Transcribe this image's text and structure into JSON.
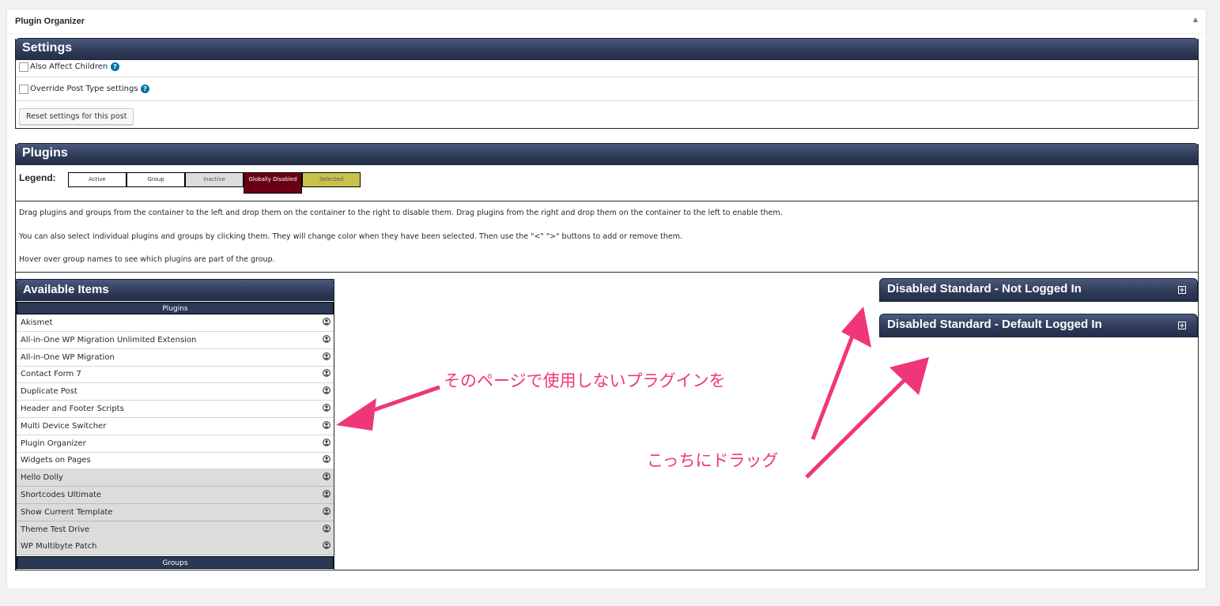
{
  "postbox": {
    "title": "Plugin Organizer"
  },
  "settings": {
    "title": "Settings",
    "also_affect_children": "Also Affect Children",
    "override_post_type": "Override Post Type settings",
    "reset_button": "Reset settings for this post"
  },
  "plugins_section": {
    "title": "Plugins",
    "legend_label": "Legend:",
    "legend": [
      {
        "label": "Active",
        "bg": "#ffffff",
        "color": "#333333"
      },
      {
        "label": "Group",
        "bg": "#ffffff",
        "color": "#333333"
      },
      {
        "label": "Inactive",
        "bg": "#dcdcdc",
        "color": "#555555"
      },
      {
        "label": "Globally Disabled",
        "bg": "#6b0014",
        "color": "#ffffff"
      },
      {
        "label": "Selected",
        "bg": "#c8c24a",
        "color": "#555555"
      }
    ],
    "desc1": "Drag plugins and groups from the container to the left and drop them on the container to the right to disable them. Drag plugins from the right and drop them on the container to the left to enable them.",
    "desc2": "You can also select individual plugins and groups by clicking them. They will change color when they have been selected. Then use the \"<\" \">\" buttons to add or remove them.",
    "desc3": "Hover over group names to see which plugins are part of the group."
  },
  "available": {
    "title": "Available Items",
    "plugins_header": "Plugins",
    "groups_header": "Groups",
    "active_items": [
      "Akismet",
      "All-in-One WP Migration Unlimited Extension",
      "All-in-One WP Migration",
      "Contact Form 7",
      "Duplicate Post",
      "Header and Footer Scripts",
      "Multi Device Switcher",
      "Plugin Organizer",
      "Widgets on Pages"
    ],
    "inactive_items": [
      "Hello Dolly",
      "Shortcodes Ultimate",
      "Show Current Template",
      "Theme Test Drive",
      "WP Multibyte Patch"
    ]
  },
  "disabled_panels": [
    {
      "title": "Disabled Standard - Not Logged In"
    },
    {
      "title": "Disabled Standard - Default Logged In"
    }
  ],
  "annotations": {
    "left_text": "そのページで使用しないプラグインを",
    "right_text": "こっちにドラッグ",
    "color": "#f0367a"
  }
}
